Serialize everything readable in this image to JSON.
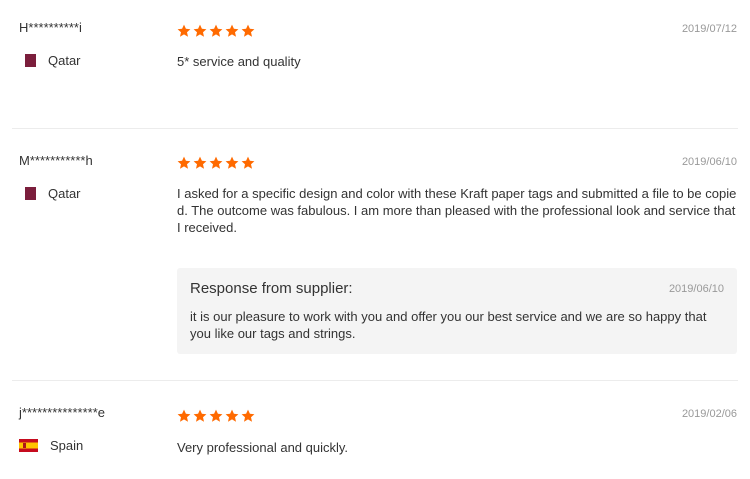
{
  "colors": {
    "star": "#ff6a00",
    "qatar_flag": "#7b1e3c"
  },
  "reviews": [
    {
      "reviewer": "H**********i",
      "country": "Qatar",
      "flag_icon": "qatar-flag-icon",
      "rating": 5,
      "date": "2019/07/12",
      "text": "5* service and quality"
    },
    {
      "reviewer": "M***********h",
      "country": "Qatar",
      "flag_icon": "qatar-flag-icon",
      "rating": 5,
      "date": "2019/06/10",
      "text": "I asked for a specific design and color with these Kraft paper tags and submitted a file to be copied. The outcome was fabulous. I am more than pleased with the professional look and service that I received.",
      "response": {
        "title": "Response from supplier:",
        "date": "2019/06/10",
        "text": "it is our pleasure to work with you and offer you our best service and we are so happy that you like our tags and strings."
      }
    },
    {
      "reviewer": "j***************e",
      "country": "Spain",
      "flag_icon": "spain-flag-icon",
      "rating": 5,
      "date": "2019/02/06",
      "text": "Very professional and quickly."
    }
  ]
}
